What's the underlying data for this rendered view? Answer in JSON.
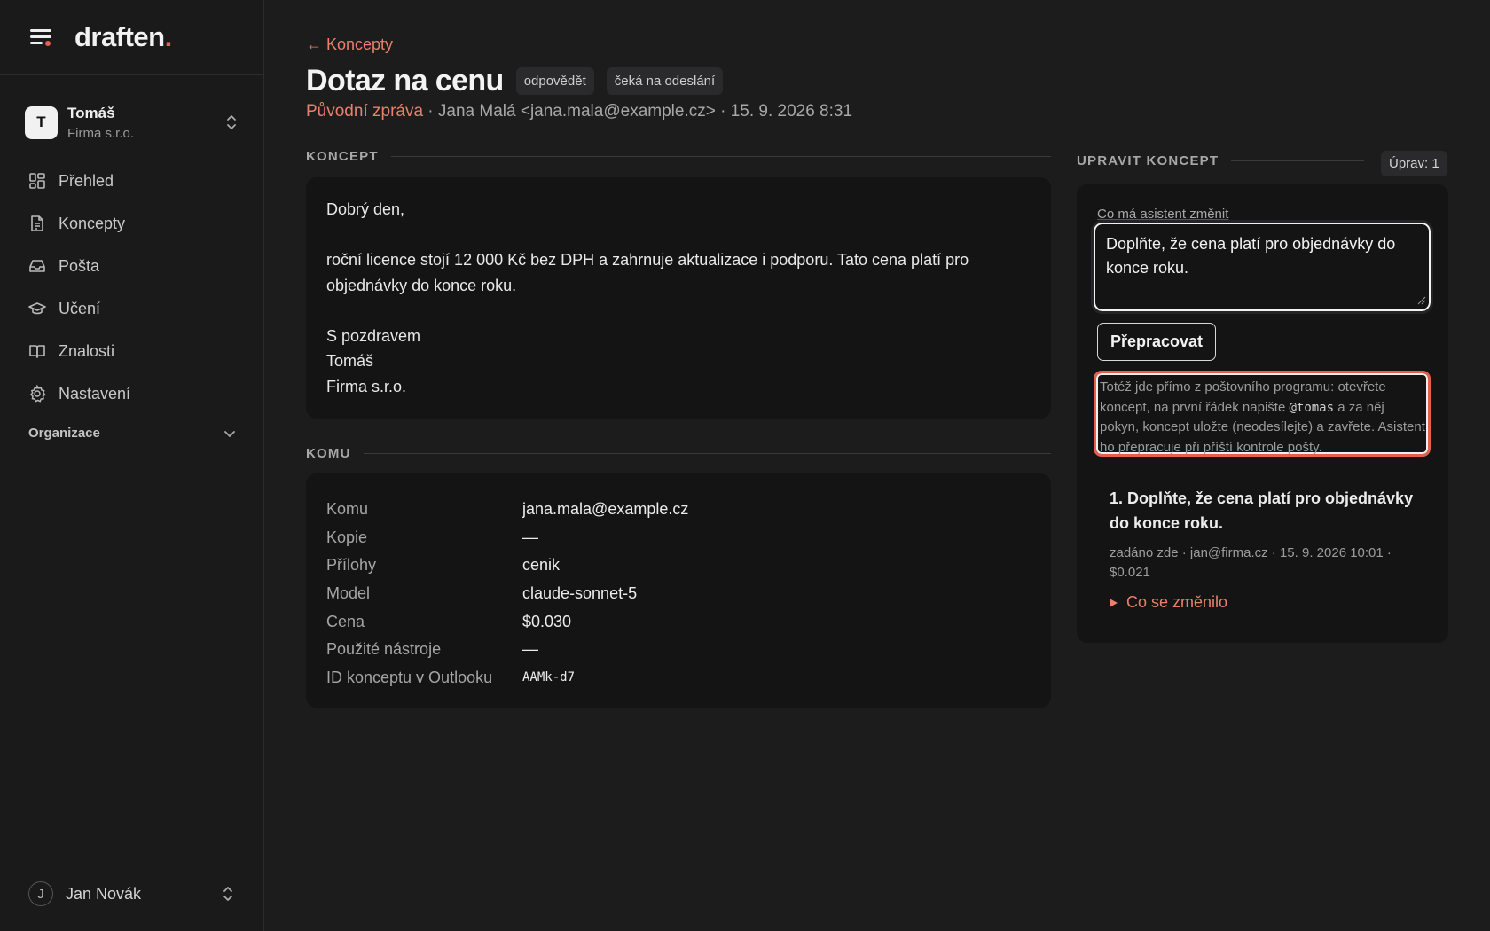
{
  "app": {
    "logo_text": "draften",
    "logo_dot": "."
  },
  "account": {
    "initial": "T",
    "name": "Tomáš",
    "org": "Firma s.r.o."
  },
  "nav": {
    "items": [
      {
        "label": "Přehled",
        "icon": "grid-icon"
      },
      {
        "label": "Koncepty",
        "icon": "document-icon"
      },
      {
        "label": "Pošta",
        "icon": "inbox-icon"
      },
      {
        "label": "Učení",
        "icon": "graduation-cap-icon"
      },
      {
        "label": "Znalosti",
        "icon": "book-icon"
      },
      {
        "label": "Nastavení",
        "icon": "gear-icon"
      }
    ],
    "org_label": "Organizace"
  },
  "user": {
    "initial": "J",
    "name": "Jan Novák"
  },
  "header": {
    "back_label": "← Koncepty",
    "title": "Dotaz na cenu",
    "badges": [
      "odpovědět",
      "čeká na odeslání"
    ],
    "original_link": "Původní zpráva",
    "meta": " · Jana Malá <jana.mala@example.cz> · 15. 9. 2026 8:31"
  },
  "draft": {
    "section_title": "KONCEPT",
    "greeting": "Dobrý den,",
    "body": "roční licence stojí 12 000 Kč bez DPH a zahrnuje aktualizace i podporu. Tato cena platí pro objednávky do konce roku.",
    "closing": "S pozdravem",
    "signature_name": "Tomáš",
    "signature_org": "Firma s.r.o."
  },
  "recipients": {
    "section_title": "KOMU",
    "rows": [
      {
        "key": "Komu",
        "value": "jana.mala@example.cz"
      },
      {
        "key": "Kopie",
        "value": "—"
      },
      {
        "key": "Přílohy",
        "value": "cenik"
      },
      {
        "key": "Model",
        "value": "claude-sonnet-5"
      },
      {
        "key": "Cena",
        "value": "$0.030"
      },
      {
        "key": "Použité nástroje",
        "value": "—"
      },
      {
        "key": "ID konceptu v Outlooku",
        "value": "AAMk-d7"
      }
    ]
  },
  "edit": {
    "section_title": "UPRAVIT KONCEPT",
    "count_label": "Úprav: 1",
    "field_label": "Co má asistent změnit",
    "textarea_value": "Doplňte, že cena platí pro objednávky do konce roku.",
    "button_label": "Přepracovat",
    "hint_before": "Totéž jde přímo z poštovního programu: otevřete koncept, na první řádek napište ",
    "hint_code": "@tomas",
    "hint_after": " a za něj pokyn, koncept uložte (neodesílejte) a zavřete. Asistent ho přepracuje při příští kontrole pošty."
  },
  "history": {
    "title": "1. Doplňte, že cena platí pro objednávky do konce roku.",
    "meta": "zadáno zde · jan@firma.cz · 15. 9. 2026 10:01 · $0.021",
    "toggle_label": "Co se změnilo"
  },
  "colors": {
    "accent": "#e8806c",
    "background": "#1c1c1d",
    "card": "#141415",
    "highlight": "#e2604c"
  }
}
